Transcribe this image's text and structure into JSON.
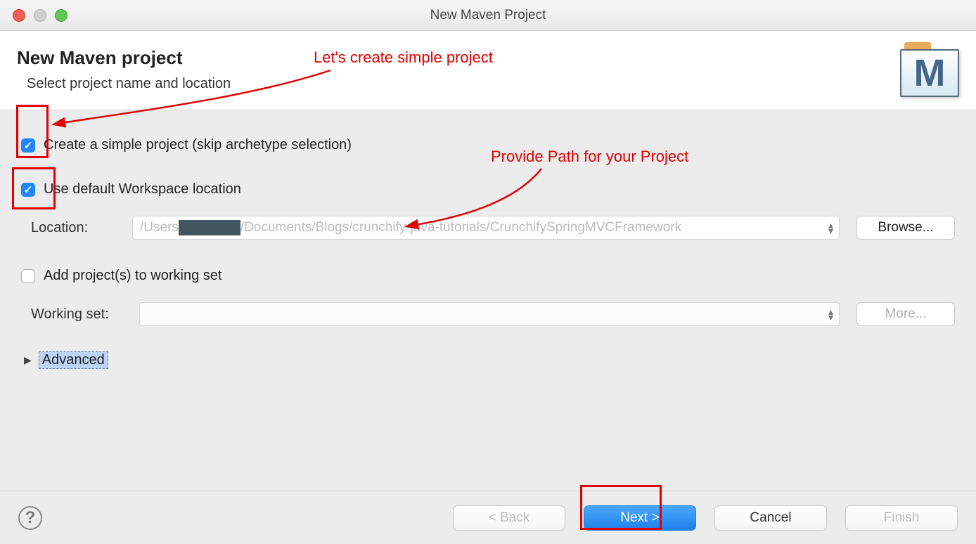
{
  "window": {
    "title": "New Maven Project"
  },
  "header": {
    "title": "New Maven project",
    "subtitle": "Select project name and location",
    "icon_letter": "M"
  },
  "form": {
    "simple_project": {
      "checked": true,
      "label": "Create a simple project (skip archetype selection)"
    },
    "default_ws": {
      "checked": true,
      "label": "Use default Workspace location"
    },
    "location_label": "Location:",
    "location_path_pre": "/Users",
    "location_path_post": "/Documents/Blogs/crunchify-java-tutorials/CrunchifySpringMVCFramework",
    "browse_label": "Browse...",
    "add_ws": {
      "checked": false,
      "label": "Add project(s) to working set"
    },
    "ws_label": "Working set:",
    "more_label": "More...",
    "advanced_label": "Advanced"
  },
  "footer": {
    "back": "< Back",
    "next": "Next >",
    "cancel": "Cancel",
    "finish": "Finish"
  },
  "annotations": {
    "a1": "Let's create simple project",
    "a2": "Provide Path for your Project"
  }
}
